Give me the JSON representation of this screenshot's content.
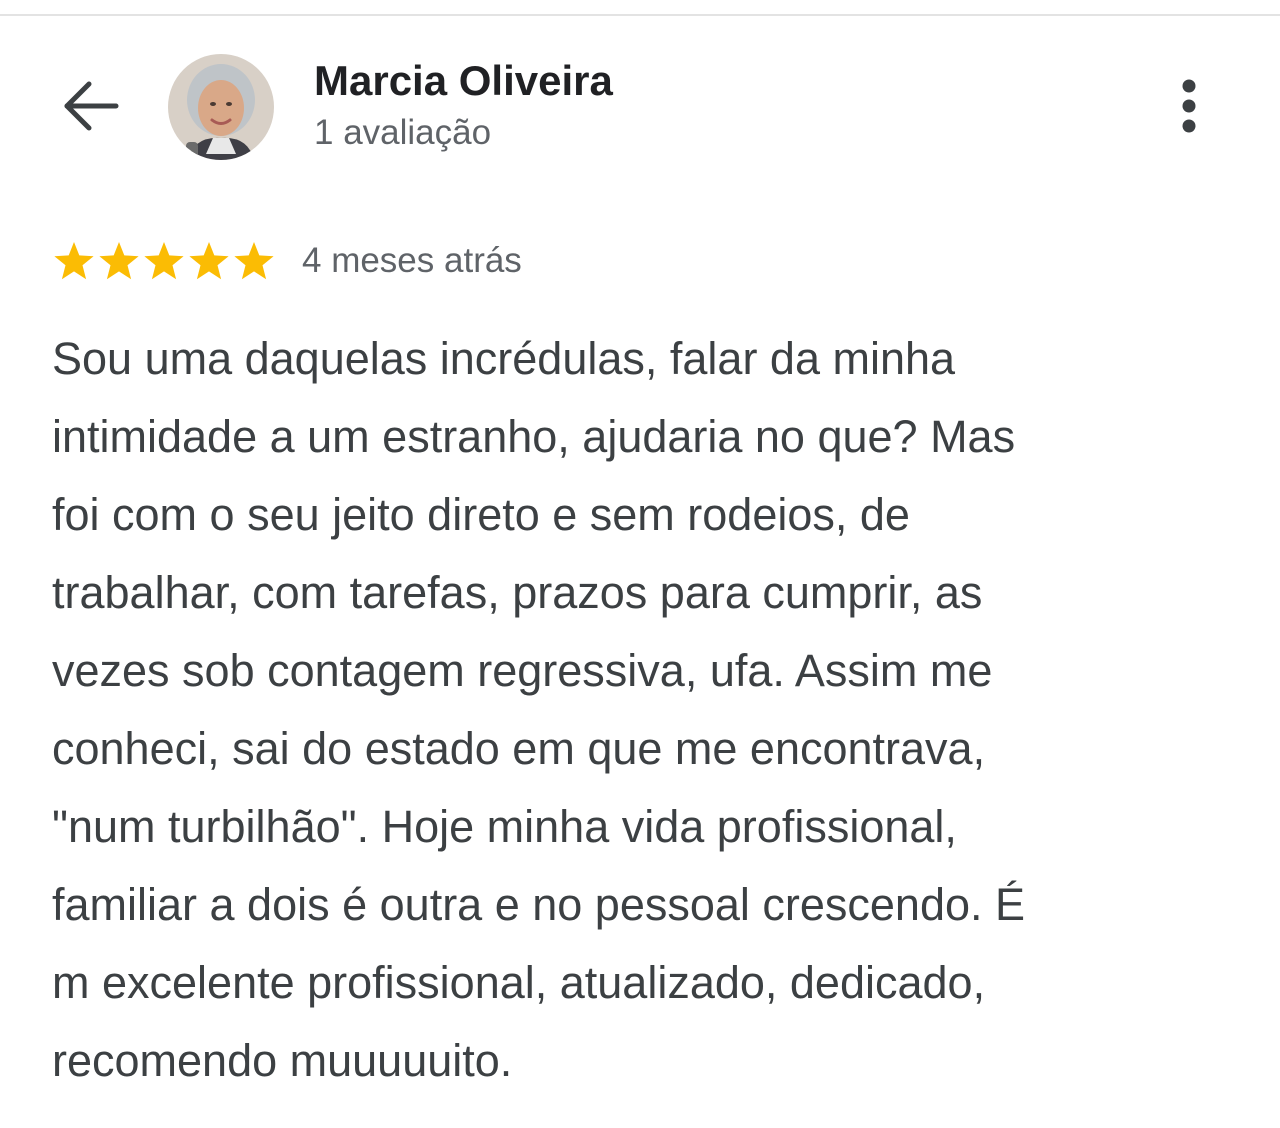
{
  "header": {
    "reviewer_name": "Marcia Oliveira",
    "review_count": "1 avaliação",
    "back_icon": "arrow-left-icon",
    "more_icon": "more-vertical-icon"
  },
  "review": {
    "rating": 5,
    "rating_max": 5,
    "star_color": "#fbbc04",
    "date": "4 meses atrás",
    "text_lines": [
      "Sou uma daquelas incrédulas, falar da minha",
      "intimidade a um estranho, ajudaria no que? Mas",
      "foi com o seu jeito direto e sem rodeios, de",
      "trabalhar, com tarefas, prazos para cumprir, as",
      "vezes sob contagem regressiva, ufa. Assim me",
      "conheci, sai do estado em que me encontrava,",
      "\"num turbilhão\". Hoje minha vida profissional,",
      "familiar a dois é outra e no pessoal crescendo. É",
      "m excelente profissional, atualizado, dedicado,",
      "recomendo muuuuuito."
    ]
  },
  "colors": {
    "name_text": "#202124",
    "secondary_text": "#5f6368",
    "body_text": "#3c4043",
    "icon": "#3c4043"
  }
}
